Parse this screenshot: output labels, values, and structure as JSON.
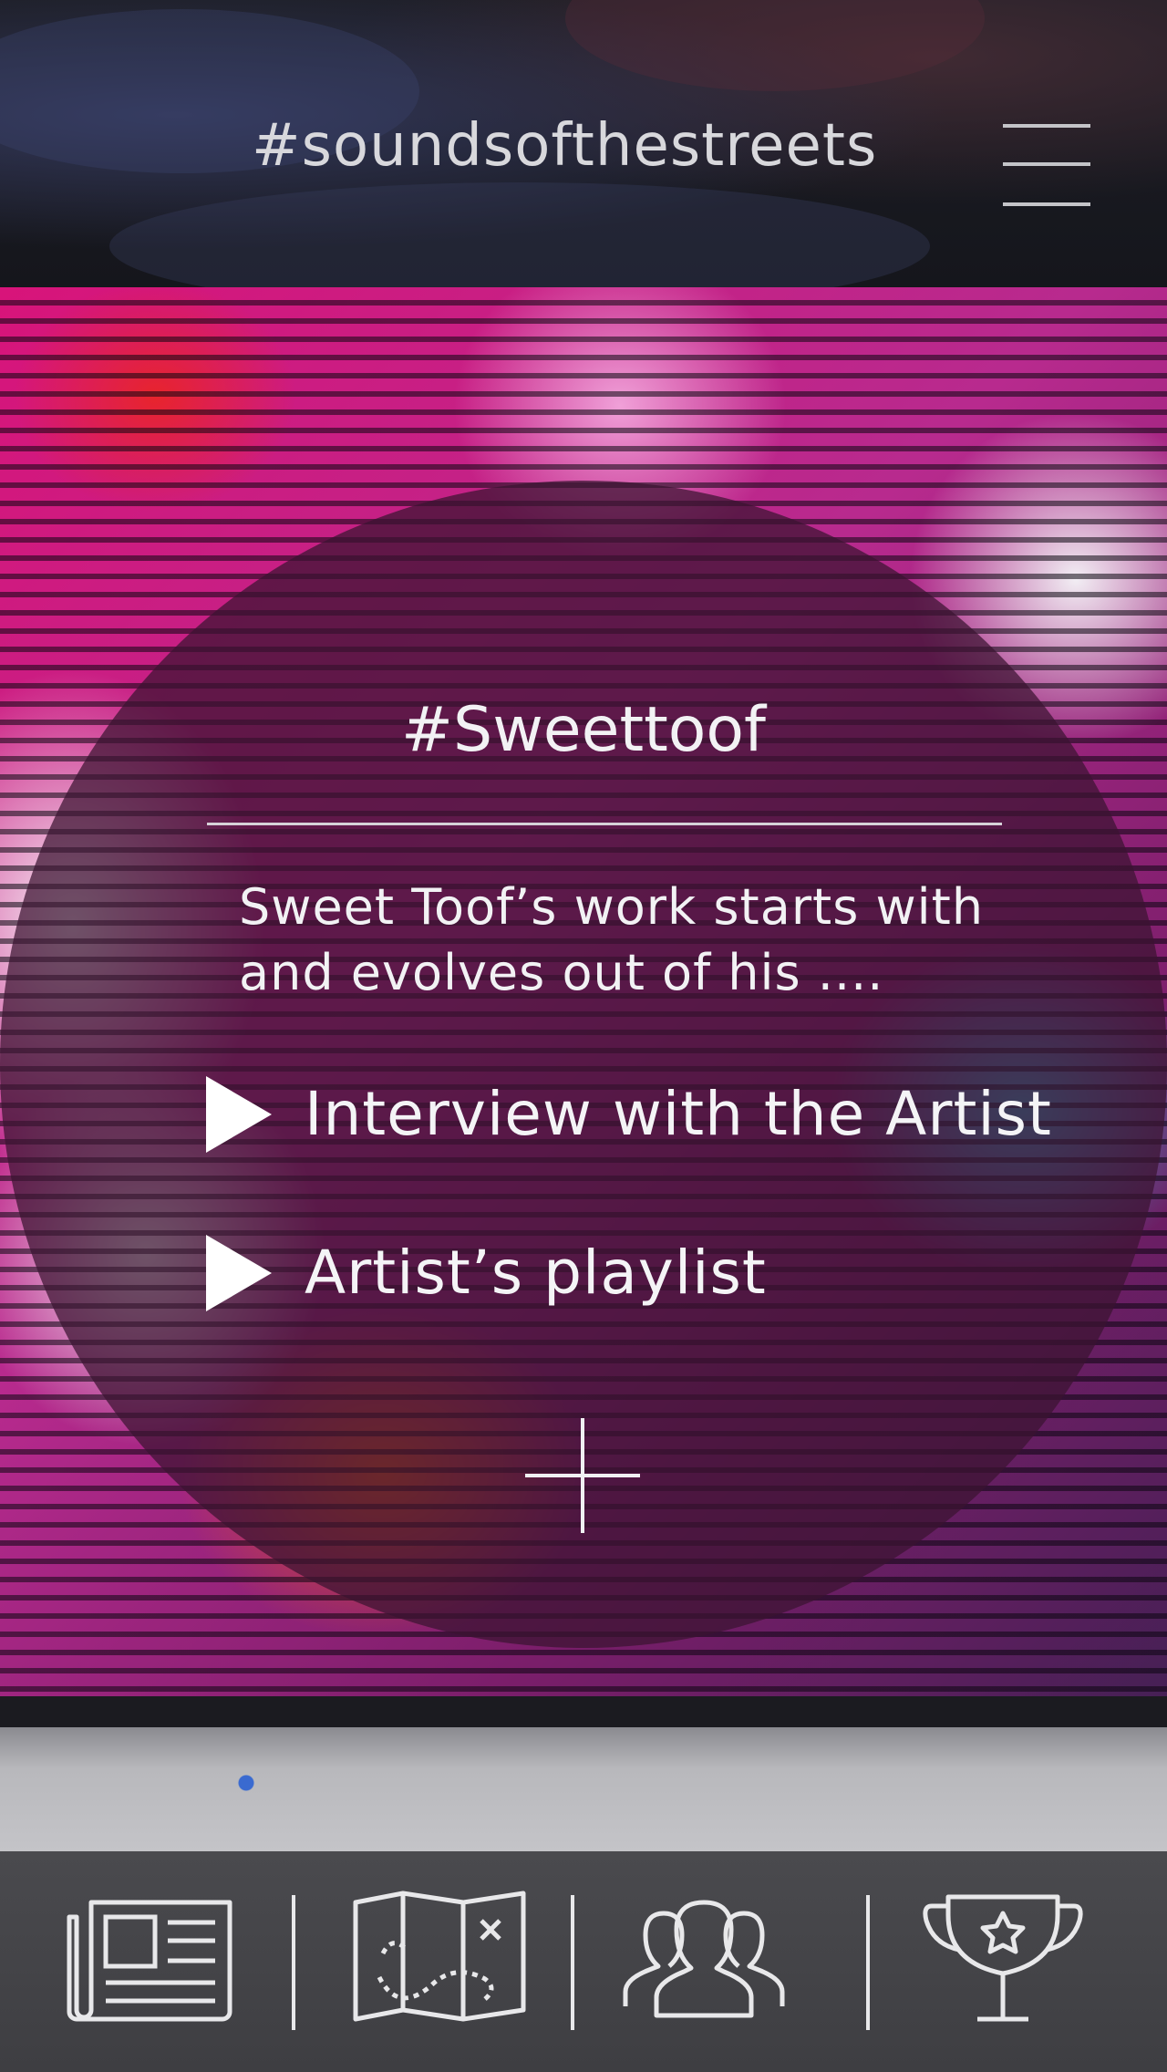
{
  "header": {
    "title": "#soundsofthestreets",
    "menu_icon": "hamburger-menu-icon"
  },
  "artist_card": {
    "tag": "#Sweettoof",
    "description_line1": "Sweet Toof’s work starts with",
    "description_line2": "and evolves out of his ....",
    "actions": [
      {
        "label": "Interview with the Artist",
        "icon": "play-icon"
      },
      {
        "label": "Artist’s playlist",
        "icon": "play-icon"
      }
    ],
    "more_icon": "plus-icon"
  },
  "bottom_nav": {
    "items": [
      {
        "name": "news",
        "icon": "newspaper-icon"
      },
      {
        "name": "map",
        "icon": "treasure-map-icon"
      },
      {
        "name": "community",
        "icon": "people-icon"
      },
      {
        "name": "awards",
        "icon": "trophy-icon"
      }
    ]
  },
  "colors": {
    "header_text": "#d8d8dc",
    "overlay": "#3a1430",
    "nav_background": "#444448",
    "icon_stroke": "#e8e8ea"
  }
}
